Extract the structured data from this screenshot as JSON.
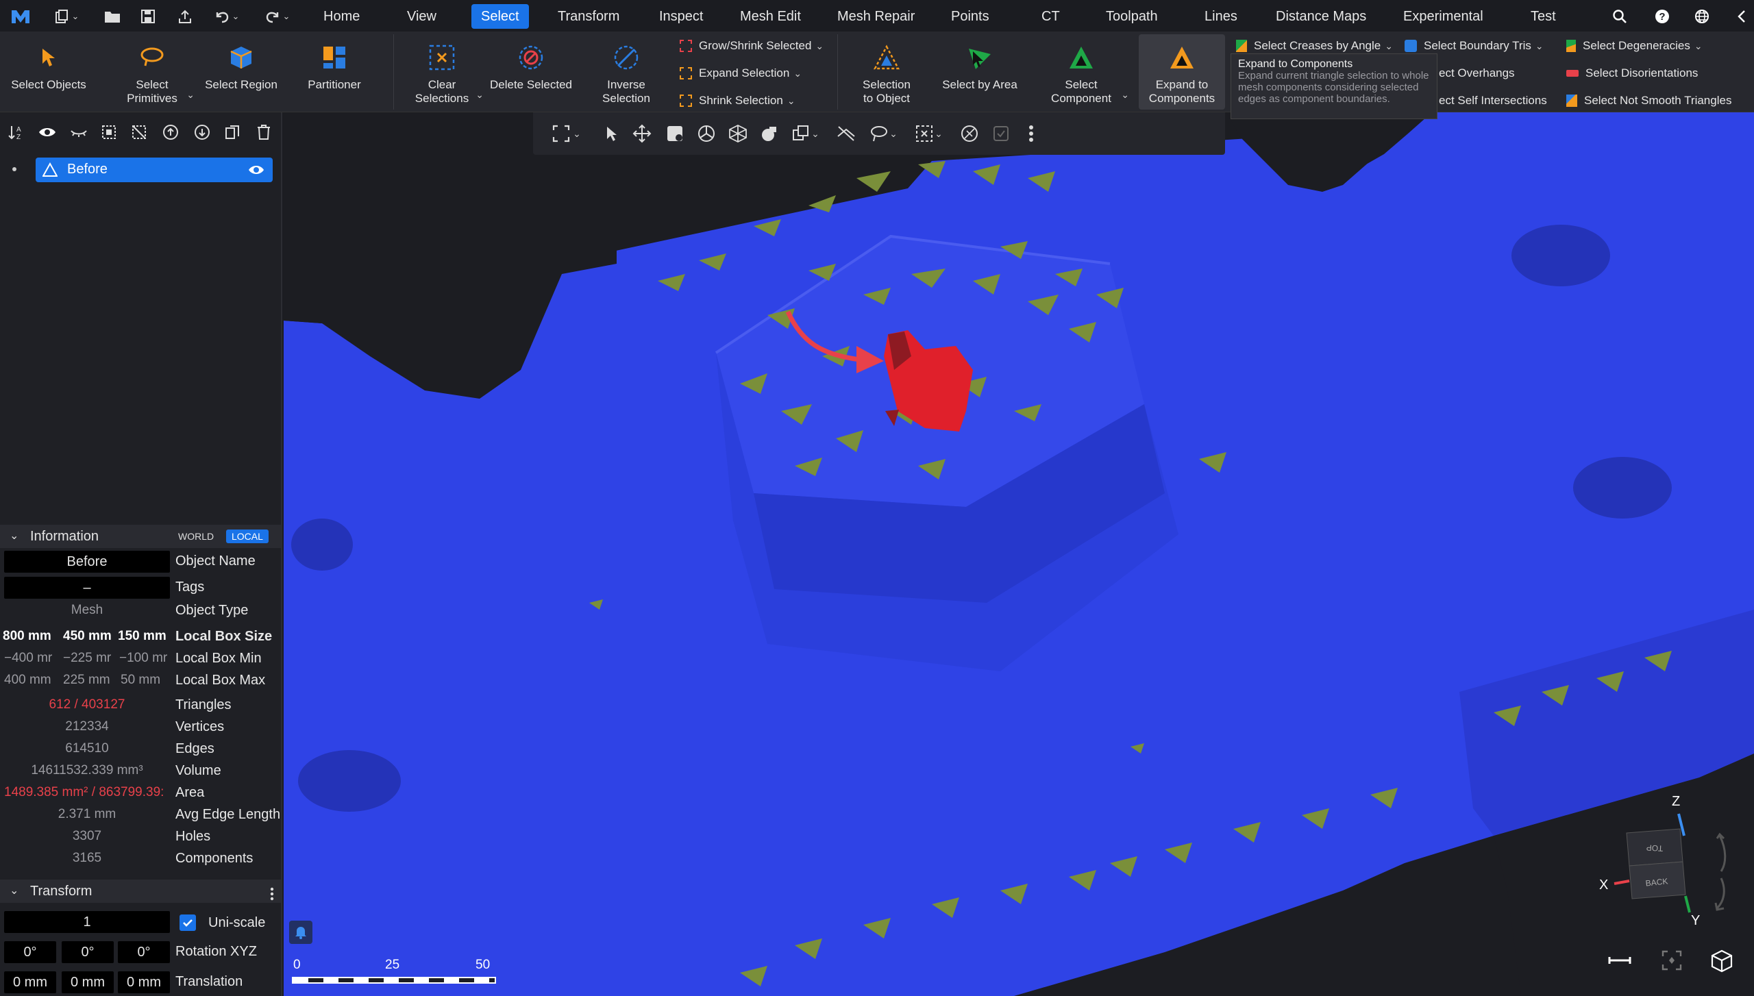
{
  "menubar": {
    "tabs": [
      "Home",
      "View",
      "Select",
      "Transform",
      "Inspect",
      "Mesh Edit",
      "Mesh Repair",
      "Points",
      "CT",
      "Toolpath",
      "Lines",
      "Distance Maps",
      "Experimental",
      "Test"
    ],
    "active_tab": "Select"
  },
  "ribbon": {
    "select_objects": "Select Objects",
    "select_primitives": "Select\nPrimitives",
    "select_region": "Select Region",
    "partitioner": "Partitioner",
    "clear_selections": "Clear\nSelections",
    "delete_selected": "Delete Selected",
    "inverse_selection": "Inverse\nSelection",
    "grow_shrink_selected": "Grow/Shrink Selected",
    "expand_selection": "Expand Selection",
    "shrink_selection": "Shrink Selection",
    "selection_to_object": "Selection\nto Object",
    "select_by_area": "Select by Area",
    "select_component": "Select\nComponent",
    "expand_to_components": "Expand to\nComponents",
    "select_creases_by_angle": "Select Creases by Angle",
    "select_boundary_tris": "Select Boundary Tris",
    "select_degeneracies": "Select Degeneracies",
    "select_overhangs": "ect Overhangs",
    "select_disorientations": "Select Disorientations",
    "select_self_intersections": "ect Self Intersections",
    "select_not_smooth_triangles": "Select Not Smooth Triangles"
  },
  "tooltip": {
    "title": "Expand to Components",
    "description": "Expand current triangle selection to whole mesh components considering selected edges as component boundaries."
  },
  "scene_tree": {
    "items": [
      {
        "label": "Before",
        "visible": true
      }
    ]
  },
  "information": {
    "header": "Information",
    "world_label": "WORLD",
    "local_label": "LOCAL",
    "object_name_value": "Before",
    "object_name_label": "Object Name",
    "tags_value": "–",
    "tags_label": "Tags",
    "object_type_value": "Mesh",
    "object_type_label": "Object Type",
    "box_size": [
      "800 mm",
      "450 mm",
      "150 mm"
    ],
    "box_size_label": "Local Box Size",
    "box_min": [
      "−400 mr",
      "−225 mr",
      "−100 mr"
    ],
    "box_min_label": "Local Box Min",
    "box_max": [
      "400 mm",
      "225 mm",
      "50 mm"
    ],
    "box_max_label": "Local Box Max",
    "triangles_value": "612 / 403127",
    "triangles_label": "Triangles",
    "vertices_value": "212334",
    "vertices_label": "Vertices",
    "edges_value": "614510",
    "edges_label": "Edges",
    "volume_value": "14611532.339 mm³",
    "volume_label": "Volume",
    "area_value": "1489.385 mm² / 863799.39:",
    "area_label": "Area",
    "avg_edge_value": "2.371 mm",
    "avg_edge_label": "Avg Edge Length",
    "holes_value": "3307",
    "holes_label": "Holes",
    "components_value": "3165",
    "components_label": "Components"
  },
  "transform": {
    "header": "Transform",
    "scale_value": "1",
    "uniscale_label": "Uni-scale",
    "uniscale_checked": true,
    "rotation": [
      "0°",
      "0°",
      "0°"
    ],
    "rotation_label": "Rotation XYZ",
    "translation": [
      "0 mm",
      "0 mm",
      "0 mm"
    ],
    "translation_label": "Translation"
  },
  "scale_bar": {
    "ticks": [
      "0",
      "25",
      "50"
    ]
  },
  "view_cube": {
    "axis_x": "X",
    "axis_y": "Y",
    "axis_z": "Z",
    "face_top": "TOP",
    "face_back": "BACK"
  },
  "colors": {
    "accent": "#1a73e8",
    "mesh_blue": "#2f43e6",
    "selection_red": "#e0202b",
    "defect_olive": "#7a8f3a",
    "highlight_red": "#e8414a"
  }
}
